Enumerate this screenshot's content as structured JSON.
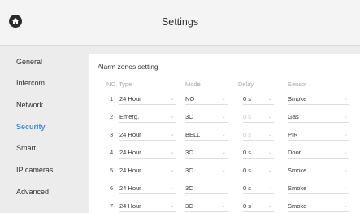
{
  "header": {
    "title": "Settings",
    "home_icon": "home-icon"
  },
  "sidebar": {
    "items": [
      {
        "label": "General"
      },
      {
        "label": "Intercom"
      },
      {
        "label": "Network"
      },
      {
        "label": "Security"
      },
      {
        "label": "Smart"
      },
      {
        "label": "IP cameras"
      },
      {
        "label": "Advanced"
      }
    ],
    "active": "Security"
  },
  "colors": {
    "accent": "#3a8ee6",
    "background": "#ececec",
    "panel": "#ffffff"
  },
  "panel": {
    "title": "Alarm zones setting",
    "columns": {
      "no": "NO.",
      "type": "Type",
      "mode": "Mode",
      "delay": "Delay",
      "sensor": "Sensor"
    },
    "rows": [
      {
        "no": "1",
        "type": "24 Hour",
        "mode": "NO",
        "delay": "0 s",
        "sensor": "Smoke",
        "delay_disabled": false
      },
      {
        "no": "2",
        "type": "Emerg.",
        "mode": "3C",
        "delay": "0 s",
        "sensor": "Gas",
        "delay_disabled": true
      },
      {
        "no": "3",
        "type": "24 Hour",
        "mode": "BELL",
        "delay": "0 s",
        "sensor": "PIR",
        "delay_disabled": true
      },
      {
        "no": "4",
        "type": "24 Hour",
        "mode": "3C",
        "delay": "0 s",
        "sensor": "Door",
        "delay_disabled": false
      },
      {
        "no": "5",
        "type": "24 Hour",
        "mode": "3C",
        "delay": "0 s",
        "sensor": "Smoke",
        "delay_disabled": false
      },
      {
        "no": "6",
        "type": "24 Hour",
        "mode": "3C",
        "delay": "0 s",
        "sensor": "Smoke",
        "delay_disabled": false
      },
      {
        "no": "7",
        "type": "24 Hour",
        "mode": "3C",
        "delay": "0 s",
        "sensor": "Smoke",
        "delay_disabled": false
      }
    ]
  }
}
